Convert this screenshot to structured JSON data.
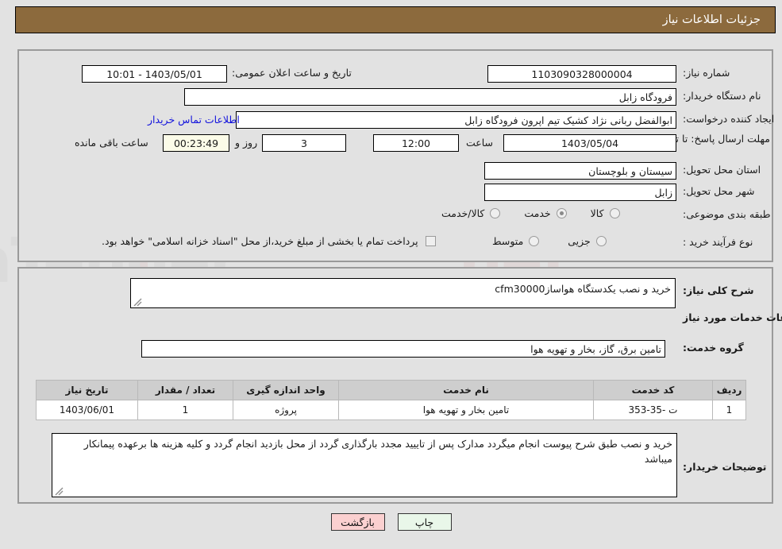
{
  "header": {
    "title": "جزئیات اطلاعات نیاز"
  },
  "colors": {
    "header_bg": "#8c6a3d",
    "page_bg": "#e2e2e2",
    "link": "#1111dd",
    "countdown_bg": "#fbfbe8",
    "table_header_bg": "#cecece",
    "print_btn_bg": "#e9f7e9",
    "back_btn_bg": "#fbd0d0"
  },
  "top_panel": {
    "need_number_label": "شماره نیاز:",
    "need_number_value": "1103090328000004",
    "public_announce_label": "تاریخ و ساعت اعلان عمومی:",
    "public_announce_value": "1403/05/01 - 10:01",
    "buyer_org_label": "نام دستگاه خریدار:",
    "buyer_org_value": "فرودگاه زابل",
    "creator_label": "ایجاد کننده درخواست:",
    "creator_value": "ابوالفضل  ربانی نژاد کشیک تیم اپرون فرودگاه زابل",
    "contact_link": "اطلاعات تماس خریدار",
    "deadline_label": "مهلت ارسال پاسخ: تا تاریخ:",
    "deadline_date": "1403/05/04",
    "hour_label": "ساعت",
    "deadline_time": "12:00",
    "days_value": "3",
    "days_label": "روز و",
    "countdown_value": "00:23:49",
    "remaining_label": "ساعت باقی مانده",
    "province_label": "استان محل تحویل:",
    "province_value": "سیستان و بلوچستان",
    "city_label": "شهر محل تحویل:",
    "city_value": "زابل",
    "category_label": "طبقه بندی موضوعی:",
    "category_options": [
      {
        "label": "کالا",
        "selected": false
      },
      {
        "label": "خدمت",
        "selected": true
      },
      {
        "label": "کالا/خدمت",
        "selected": false
      }
    ],
    "process_label": "نوع فرآیند خرید :",
    "process_options": [
      {
        "label": "جزیی",
        "selected": false
      },
      {
        "label": "متوسط",
        "selected": false
      }
    ],
    "treasury_checkbox_checked": false,
    "treasury_note": "پرداخت تمام یا بخشی از مبلغ خرید،از محل \"اسناد خزانه اسلامی\" خواهد بود."
  },
  "mid_panel": {
    "general_desc_label": "شرح کلی نیاز:",
    "general_desc_value": "خرید و نصب یکدستگاه هواسازcfm30000",
    "services_section_title": "اطلاعات خدمات مورد نیاز",
    "service_group_label": "گروه خدمت:",
    "service_group_value": "تامین برق، گاز، بخار و تهویه هوا",
    "table": {
      "columns": [
        "ردیف",
        "کد خدمت",
        "نام خدمت",
        "واحد اندازه گیری",
        "تعداد / مقدار",
        "تاریخ نیاز"
      ],
      "rows": [
        [
          "1",
          "ت -35-353",
          "تامین بخار و تهویه هوا",
          "پروژه",
          "1",
          "1403/06/01"
        ]
      ]
    },
    "buyer_notes_label": "توضیحات خریدار:",
    "buyer_notes_value": "خرید و نصب طبق شرح پیوست انجام میگردد مدارک پس از تاییید مجدد بارگذاری گردد از محل بازدید انجام گردد و کلیه هزینه ها برعهده پیمانکار میباشد"
  },
  "footer": {
    "print_label": "چاپ",
    "back_label": "بازگشت"
  },
  "watermark": {
    "text": "AnaTender.net"
  }
}
